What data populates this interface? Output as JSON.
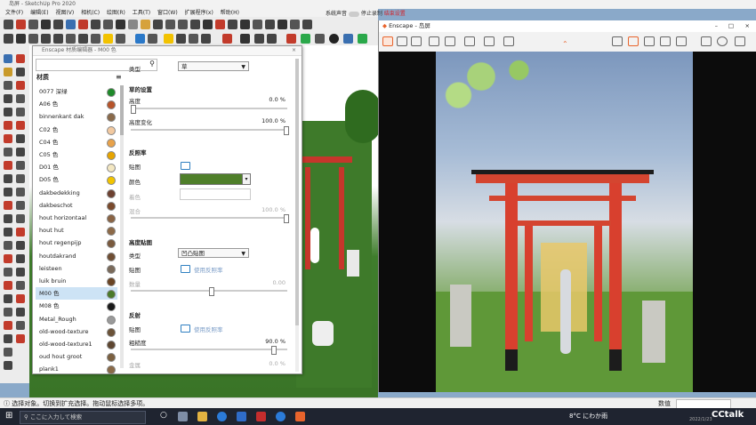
{
  "sketchup": {
    "window_title": "岛屏 - SketchUp Pro 2020",
    "menu": [
      "文件(F)",
      "编辑(E)",
      "视图(V)",
      "相机(C)",
      "绘图(R)",
      "工具(T)",
      "窗口(W)",
      "扩展程序(x)",
      "帮助(H)"
    ],
    "status_text": "选择对象。切换到扩充选择。拖动鼠标选择多项。",
    "status_value_label": "数值"
  },
  "recording": {
    "mic_label": "系统声音",
    "stop_label": "停止录制",
    "settings_label": "结束设置"
  },
  "materials": {
    "title": "Enscape 材质编辑器 - M00 色",
    "header": "材质",
    "items": [
      {
        "name": "0077 深绿",
        "color": "#1f8a2a"
      },
      {
        "name": "A06 色",
        "color": "#b7542a"
      },
      {
        "name": "binnenkant dak",
        "color": "#8a6a4a"
      },
      {
        "name": "C02 色",
        "color": "#f2c9a0"
      },
      {
        "name": "C04 色",
        "color": "#e8a24a"
      },
      {
        "name": "C05 色",
        "color": "#e6a400"
      },
      {
        "name": "D01 色",
        "color": "#f3e7c2"
      },
      {
        "name": "D05 色",
        "color": "#f2c400"
      },
      {
        "name": "dakbedekking",
        "color": "#6d4130"
      },
      {
        "name": "dakbeschot",
        "color": "#7a4a2c"
      },
      {
        "name": "hout horizontaal",
        "color": "#8a6444"
      },
      {
        "name": "hout hut",
        "color": "#8d6a48"
      },
      {
        "name": "hout regenpijp",
        "color": "#7a5a3e"
      },
      {
        "name": "houtdakrand",
        "color": "#6f4e33"
      },
      {
        "name": "leisteen",
        "color": "#7a6a5a"
      },
      {
        "name": "luik bruin",
        "color": "#6a4424"
      },
      {
        "name": "M00 色",
        "color": "#4a7a2a"
      },
      {
        "name": "M08 色",
        "color": "#1a1a1a"
      },
      {
        "name": "Metal_Rough",
        "color": "#9a9a9a"
      },
      {
        "name": "old-wood-texture",
        "color": "#6b5238"
      },
      {
        "name": "old-wood-texture1",
        "color": "#5e4630"
      },
      {
        "name": "oud hout groot",
        "color": "#7b6040"
      },
      {
        "name": "plank1",
        "color": "#8a6a48"
      }
    ],
    "selected_index": 16,
    "type_label": "类型",
    "type_value": "草",
    "grass_section": "草的设置",
    "height_label": "高度",
    "height_value": "0.0 %",
    "height_var_label": "高度变化",
    "height_var_value": "100.0 %",
    "albedo_section": "反照率",
    "texture_label": "贴图",
    "color_label": "颜色",
    "tint_label": "着色",
    "color_swatch": "#4f7f2a",
    "opacity_label": "混合",
    "opacity_value": "100.0 %",
    "bump_section": "高度贴图",
    "bump_type_label": "类型",
    "bump_type_value": "凹凸贴图",
    "bump_texture_label": "贴图",
    "bump_texture_link": "使用反照率",
    "bump_amount_label": "数量",
    "bump_amount_value": "0.00",
    "reflect_section": "反射",
    "reflect_texture_label": "贴图",
    "reflect_texture_link": "使用反照率",
    "roughness_label": "粗糙度",
    "roughness_value": "90.0 %",
    "metal_label": "金属",
    "metal_value": "0.0 %"
  },
  "enscape": {
    "window_title": "Enscape - 岛屏"
  },
  "taskbar": {
    "search_placeholder": "ここに入力して検索",
    "weather": "8°C にわか雨",
    "date": "2022/1/23",
    "brand": "CCtalk"
  }
}
